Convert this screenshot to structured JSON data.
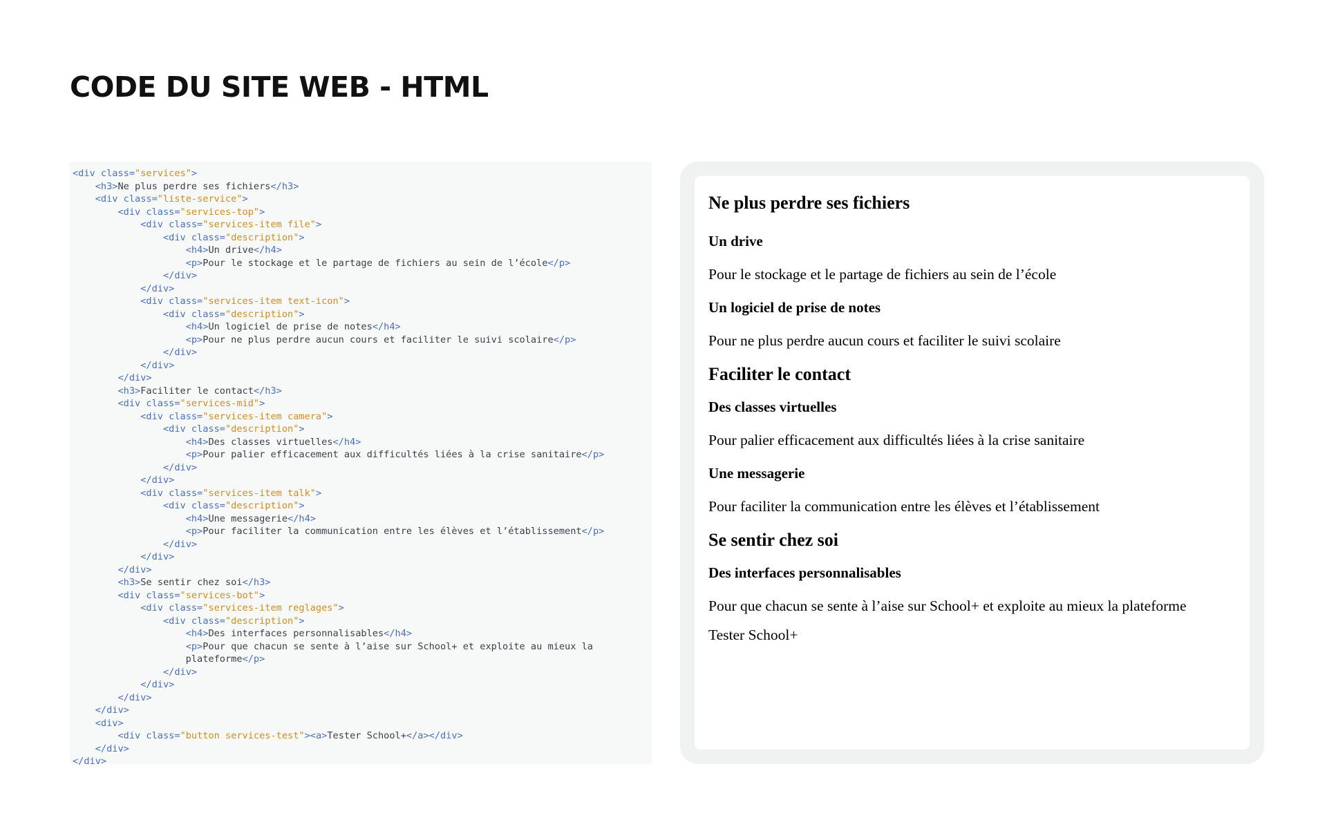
{
  "page": {
    "title": "CODE DU SITE WEB - HTML"
  },
  "code": {
    "lines": [
      [
        {
          "t": "tag",
          "v": "<div "
        },
        {
          "t": "attr",
          "v": "class="
        },
        {
          "t": "str",
          "v": "\"services\""
        },
        {
          "t": "tag",
          "v": ">"
        }
      ],
      [
        {
          "t": "txt",
          "v": "    "
        },
        {
          "t": "tag",
          "v": "<h3>"
        },
        {
          "t": "txt",
          "v": "Ne plus perdre ses fichiers"
        },
        {
          "t": "tag",
          "v": "</h3>"
        }
      ],
      [
        {
          "t": "txt",
          "v": "    "
        },
        {
          "t": "tag",
          "v": "<div "
        },
        {
          "t": "attr",
          "v": "class="
        },
        {
          "t": "str",
          "v": "\"liste-service\""
        },
        {
          "t": "tag",
          "v": ">"
        }
      ],
      [
        {
          "t": "txt",
          "v": "        "
        },
        {
          "t": "tag",
          "v": "<div "
        },
        {
          "t": "attr",
          "v": "class="
        },
        {
          "t": "str",
          "v": "\"services-top\""
        },
        {
          "t": "tag",
          "v": ">"
        }
      ],
      [
        {
          "t": "txt",
          "v": "            "
        },
        {
          "t": "tag",
          "v": "<div "
        },
        {
          "t": "attr",
          "v": "class="
        },
        {
          "t": "str",
          "v": "\"services-item file\""
        },
        {
          "t": "tag",
          "v": ">"
        }
      ],
      [
        {
          "t": "txt",
          "v": "                "
        },
        {
          "t": "tag",
          "v": "<div "
        },
        {
          "t": "attr",
          "v": "class="
        },
        {
          "t": "str",
          "v": "\"description\""
        },
        {
          "t": "tag",
          "v": ">"
        }
      ],
      [
        {
          "t": "txt",
          "v": "                    "
        },
        {
          "t": "tag",
          "v": "<h4>"
        },
        {
          "t": "txt",
          "v": "Un drive"
        },
        {
          "t": "tag",
          "v": "</h4>"
        }
      ],
      [
        {
          "t": "txt",
          "v": "                    "
        },
        {
          "t": "tag",
          "v": "<p>"
        },
        {
          "t": "txt",
          "v": "Pour le stockage et le partage de fichiers au sein de l’école"
        },
        {
          "t": "tag",
          "v": "</p>"
        }
      ],
      [
        {
          "t": "txt",
          "v": "                "
        },
        {
          "t": "tag",
          "v": "</div>"
        }
      ],
      [
        {
          "t": "txt",
          "v": "            "
        },
        {
          "t": "tag",
          "v": "</div>"
        }
      ],
      [
        {
          "t": "txt",
          "v": "            "
        },
        {
          "t": "tag",
          "v": "<div "
        },
        {
          "t": "attr",
          "v": "class="
        },
        {
          "t": "str",
          "v": "\"services-item text-icon\""
        },
        {
          "t": "tag",
          "v": ">"
        }
      ],
      [
        {
          "t": "txt",
          "v": "                "
        },
        {
          "t": "tag",
          "v": "<div "
        },
        {
          "t": "attr",
          "v": "class="
        },
        {
          "t": "str",
          "v": "\"description\""
        },
        {
          "t": "tag",
          "v": ">"
        }
      ],
      [
        {
          "t": "txt",
          "v": "                    "
        },
        {
          "t": "tag",
          "v": "<h4>"
        },
        {
          "t": "txt",
          "v": "Un logiciel de prise de notes"
        },
        {
          "t": "tag",
          "v": "</h4>"
        }
      ],
      [
        {
          "t": "txt",
          "v": "                    "
        },
        {
          "t": "tag",
          "v": "<p>"
        },
        {
          "t": "txt",
          "v": "Pour ne plus perdre aucun cours et faciliter le suivi scolaire"
        },
        {
          "t": "tag",
          "v": "</p>"
        }
      ],
      [
        {
          "t": "txt",
          "v": "                "
        },
        {
          "t": "tag",
          "v": "</div>"
        }
      ],
      [
        {
          "t": "txt",
          "v": "            "
        },
        {
          "t": "tag",
          "v": "</div>"
        }
      ],
      [
        {
          "t": "txt",
          "v": "        "
        },
        {
          "t": "tag",
          "v": "</div>"
        }
      ],
      [
        {
          "t": "txt",
          "v": "        "
        },
        {
          "t": "tag",
          "v": "<h3>"
        },
        {
          "t": "txt",
          "v": "Faciliter le contact"
        },
        {
          "t": "tag",
          "v": "</h3>"
        }
      ],
      [
        {
          "t": "txt",
          "v": "        "
        },
        {
          "t": "tag",
          "v": "<div "
        },
        {
          "t": "attr",
          "v": "class="
        },
        {
          "t": "str",
          "v": "\"services-mid\""
        },
        {
          "t": "tag",
          "v": ">"
        }
      ],
      [
        {
          "t": "txt",
          "v": "            "
        },
        {
          "t": "tag",
          "v": "<div "
        },
        {
          "t": "attr",
          "v": "class="
        },
        {
          "t": "str",
          "v": "\"services-item camera\""
        },
        {
          "t": "tag",
          "v": ">"
        }
      ],
      [
        {
          "t": "txt",
          "v": "                "
        },
        {
          "t": "tag",
          "v": "<div "
        },
        {
          "t": "attr",
          "v": "class="
        },
        {
          "t": "str",
          "v": "\"description\""
        },
        {
          "t": "tag",
          "v": ">"
        }
      ],
      [
        {
          "t": "txt",
          "v": "                    "
        },
        {
          "t": "tag",
          "v": "<h4>"
        },
        {
          "t": "txt",
          "v": "Des classes virtuelles"
        },
        {
          "t": "tag",
          "v": "</h4>"
        }
      ],
      [
        {
          "t": "txt",
          "v": "                    "
        },
        {
          "t": "tag",
          "v": "<p>"
        },
        {
          "t": "txt",
          "v": "Pour palier efficacement aux difficultés liées à la crise sanitaire"
        },
        {
          "t": "tag",
          "v": "</p>"
        }
      ],
      [
        {
          "t": "txt",
          "v": "                "
        },
        {
          "t": "tag",
          "v": "</div>"
        }
      ],
      [
        {
          "t": "txt",
          "v": "            "
        },
        {
          "t": "tag",
          "v": "</div>"
        }
      ],
      [
        {
          "t": "txt",
          "v": "            "
        },
        {
          "t": "tag",
          "v": "<div "
        },
        {
          "t": "attr",
          "v": "class="
        },
        {
          "t": "str",
          "v": "\"services-item talk\""
        },
        {
          "t": "tag",
          "v": ">"
        }
      ],
      [
        {
          "t": "txt",
          "v": "                "
        },
        {
          "t": "tag",
          "v": "<div "
        },
        {
          "t": "attr",
          "v": "class="
        },
        {
          "t": "str",
          "v": "\"description\""
        },
        {
          "t": "tag",
          "v": ">"
        }
      ],
      [
        {
          "t": "txt",
          "v": "                    "
        },
        {
          "t": "tag",
          "v": "<h4>"
        },
        {
          "t": "txt",
          "v": "Une messagerie"
        },
        {
          "t": "tag",
          "v": "</h4>"
        }
      ],
      [
        {
          "t": "txt",
          "v": "                    "
        },
        {
          "t": "tag",
          "v": "<p>"
        },
        {
          "t": "txt",
          "v": "Pour faciliter la communication entre les élèves et l’établissement"
        },
        {
          "t": "tag",
          "v": "</p>"
        }
      ],
      [
        {
          "t": "txt",
          "v": "                "
        },
        {
          "t": "tag",
          "v": "</div>"
        }
      ],
      [
        {
          "t": "txt",
          "v": "            "
        },
        {
          "t": "tag",
          "v": "</div>"
        }
      ],
      [
        {
          "t": "txt",
          "v": "        "
        },
        {
          "t": "tag",
          "v": "</div>"
        }
      ],
      [
        {
          "t": "txt",
          "v": "        "
        },
        {
          "t": "tag",
          "v": "<h3>"
        },
        {
          "t": "txt",
          "v": "Se sentir chez soi"
        },
        {
          "t": "tag",
          "v": "</h3>"
        }
      ],
      [
        {
          "t": "txt",
          "v": "        "
        },
        {
          "t": "tag",
          "v": "<div "
        },
        {
          "t": "attr",
          "v": "class="
        },
        {
          "t": "str",
          "v": "\"services-bot\""
        },
        {
          "t": "tag",
          "v": ">"
        }
      ],
      [
        {
          "t": "txt",
          "v": "            "
        },
        {
          "t": "tag",
          "v": "<div "
        },
        {
          "t": "attr",
          "v": "class="
        },
        {
          "t": "str",
          "v": "\"services-item reglages\""
        },
        {
          "t": "tag",
          "v": ">"
        }
      ],
      [
        {
          "t": "txt",
          "v": "                "
        },
        {
          "t": "tag",
          "v": "<div "
        },
        {
          "t": "attr",
          "v": "class="
        },
        {
          "t": "str",
          "v": "\"description\""
        },
        {
          "t": "tag",
          "v": ">"
        }
      ],
      [
        {
          "t": "txt",
          "v": "                    "
        },
        {
          "t": "tag",
          "v": "<h4>"
        },
        {
          "t": "txt",
          "v": "Des interfaces personnalisables"
        },
        {
          "t": "tag",
          "v": "</h4>"
        }
      ],
      [
        {
          "t": "txt",
          "v": "                    "
        },
        {
          "t": "tag",
          "v": "<p>"
        },
        {
          "t": "txt",
          "v": "Pour que chacun se sente à l’aise sur School+ et exploite au mieux la"
        }
      ],
      [
        {
          "t": "txt",
          "v": "                    plateforme"
        },
        {
          "t": "tag",
          "v": "</p>"
        }
      ],
      [
        {
          "t": "txt",
          "v": "                "
        },
        {
          "t": "tag",
          "v": "</div>"
        }
      ],
      [
        {
          "t": "txt",
          "v": "            "
        },
        {
          "t": "tag",
          "v": "</div>"
        }
      ],
      [
        {
          "t": "txt",
          "v": "        "
        },
        {
          "t": "tag",
          "v": "</div>"
        }
      ],
      [
        {
          "t": "txt",
          "v": "    "
        },
        {
          "t": "tag",
          "v": "</div>"
        }
      ],
      [
        {
          "t": "txt",
          "v": "    "
        },
        {
          "t": "tag",
          "v": "<div>"
        }
      ],
      [
        {
          "t": "txt",
          "v": "        "
        },
        {
          "t": "tag",
          "v": "<div "
        },
        {
          "t": "attr",
          "v": "class="
        },
        {
          "t": "str",
          "v": "\"button services-test\""
        },
        {
          "t": "tag",
          "v": "><a>"
        },
        {
          "t": "txt",
          "v": "Tester School+"
        },
        {
          "t": "tag",
          "v": "</a></div>"
        }
      ],
      [
        {
          "t": "txt",
          "v": "    "
        },
        {
          "t": "tag",
          "v": "</div>"
        }
      ],
      [
        {
          "t": "tag",
          "v": "</div>"
        }
      ]
    ]
  },
  "preview": {
    "items": [
      {
        "kind": "h3",
        "text": "Ne plus perdre ses fichiers"
      },
      {
        "kind": "h4",
        "text": "Un drive"
      },
      {
        "kind": "p",
        "text": "Pour le stockage et le partage de fichiers au sein de l’école"
      },
      {
        "kind": "h4",
        "text": "Un logiciel de prise de notes"
      },
      {
        "kind": "p",
        "text": "Pour ne plus perdre aucun cours et faciliter le suivi scolaire"
      },
      {
        "kind": "h3",
        "text": "Faciliter le contact"
      },
      {
        "kind": "h4",
        "text": "Des classes virtuelles"
      },
      {
        "kind": "p",
        "text": "Pour palier efficacement aux difficultés liées à la crise sanitaire"
      },
      {
        "kind": "h4",
        "text": "Une messagerie"
      },
      {
        "kind": "p",
        "text": "Pour faciliter la communication entre les élèves et l’établissement"
      },
      {
        "kind": "h3",
        "text": "Se sentir chez soi"
      },
      {
        "kind": "h4",
        "text": "Des interfaces personnalisables"
      },
      {
        "kind": "p",
        "text": "Pour que chacun se sente à l’aise sur School+ et exploite au mieux la plateforme"
      },
      {
        "kind": "a",
        "text": "Tester School+"
      }
    ]
  }
}
